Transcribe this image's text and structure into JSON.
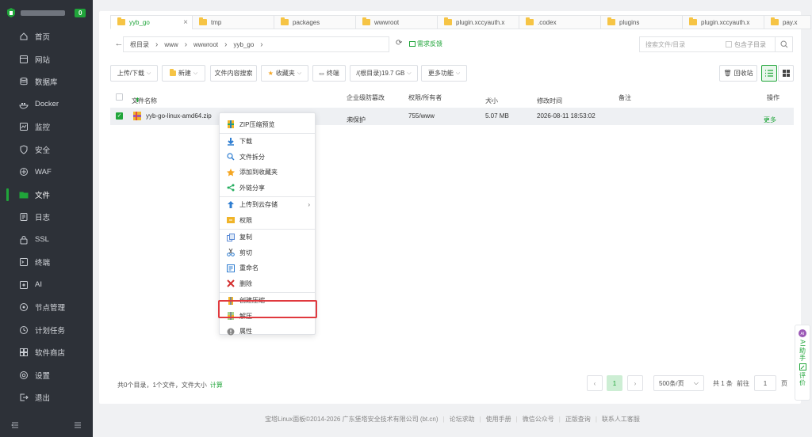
{
  "sidebar": {
    "badge": "0",
    "items": [
      {
        "label": "首页",
        "icon": "home-icon"
      },
      {
        "label": "网站",
        "icon": "website-icon"
      },
      {
        "label": "数据库",
        "icon": "database-icon"
      },
      {
        "label": "Docker",
        "icon": "docker-icon"
      },
      {
        "label": "监控",
        "icon": "monitor-icon"
      },
      {
        "label": "安全",
        "icon": "shield-icon"
      },
      {
        "label": "WAF",
        "icon": "waf-icon"
      },
      {
        "label": "文件",
        "icon": "folder-icon",
        "active": true
      },
      {
        "label": "日志",
        "icon": "log-icon"
      },
      {
        "label": "SSL",
        "icon": "ssl-icon"
      },
      {
        "label": "终端",
        "icon": "terminal-icon"
      },
      {
        "label": "AI",
        "icon": "ai-icon"
      },
      {
        "label": "节点管理",
        "icon": "node-icon"
      },
      {
        "label": "计划任务",
        "icon": "clock-icon"
      },
      {
        "label": "软件商店",
        "icon": "store-icon"
      },
      {
        "label": "设置",
        "icon": "gear-icon"
      },
      {
        "label": "退出",
        "icon": "logout-icon"
      }
    ]
  },
  "tabs": [
    {
      "label": "yyb_go",
      "active": true
    },
    {
      "label": "tmp"
    },
    {
      "label": "packages"
    },
    {
      "label": "wwwroot"
    },
    {
      "label": "plugin.xccyauth.x"
    },
    {
      "label": ".codex"
    },
    {
      "label": "plugins"
    },
    {
      "label": "plugin.xccyauth.x"
    },
    {
      "label": "pay.x"
    }
  ],
  "breadcrumb": [
    "根目录",
    "www",
    "wwwroot",
    "yyb_go"
  ],
  "feedback": "需求反馈",
  "search": {
    "placeholder": "搜索文件/目录",
    "include_sub": "包含子目录"
  },
  "toolbar": {
    "upload": "上传/下载",
    "new": "新建",
    "content_search": "文件内容搜索",
    "favorites": "收藏夹",
    "terminal": "终端",
    "disk": "/(根目录)19.7 GB",
    "more": "更多功能",
    "recycle": "回收站"
  },
  "table": {
    "headers": {
      "name": "文件名称",
      "protect": "企业级防篡改",
      "perm": "权限/所有者",
      "size": "大小",
      "mtime": "修改时间",
      "note": "备注",
      "ops": "操作"
    },
    "rows": [
      {
        "name": "yyb-go-linux-amd64.zip",
        "protect": "未保护",
        "perm": "755/www",
        "size": "5.07 MB",
        "mtime": "2026-08-11 18:53:02",
        "note": "",
        "ops": "更多"
      }
    ]
  },
  "context_menu": {
    "groups": [
      [
        {
          "label": "ZIP压缩预览",
          "icon": "zip-preview-icon"
        }
      ],
      [
        {
          "label": "下载",
          "icon": "download-icon"
        },
        {
          "label": "文件拆分",
          "icon": "split-icon"
        },
        {
          "label": "添加到收藏夹",
          "icon": "star-icon"
        },
        {
          "label": "外链分享",
          "icon": "share-icon"
        }
      ],
      [
        {
          "label": "上传到云存储",
          "icon": "cloud-upload-icon",
          "submenu": true
        },
        {
          "label": "权限",
          "icon": "permission-icon"
        }
      ],
      [
        {
          "label": "复制",
          "icon": "copy-icon"
        },
        {
          "label": "剪切",
          "icon": "cut-icon"
        },
        {
          "label": "重命名",
          "icon": "rename-icon"
        },
        {
          "label": "删除",
          "icon": "delete-icon"
        }
      ],
      [
        {
          "label": "创建压缩",
          "icon": "compress-icon"
        },
        {
          "label": "解压",
          "icon": "extract-icon",
          "highlighted": true
        },
        {
          "label": "属性",
          "icon": "info-icon"
        }
      ]
    ]
  },
  "summary": {
    "text": "共0个目录，1个文件，文件大小",
    "calc": "计算"
  },
  "pager": {
    "current": "1",
    "per_page": "500条/页",
    "total": "共 1 条",
    "goto": "前往",
    "goto_value": "1",
    "page_unit": "页"
  },
  "copyright": [
    "宝塔Linux面板©2014-2026 广东堡塔安全技术有限公司 (bt.cn)",
    "论坛求助",
    "使用手册",
    "微信公众号",
    "正版查询",
    "联系人工客服"
  ],
  "float": {
    "ai": "AI助手",
    "review": "评价"
  },
  "colors": {
    "accent": "#20a53a",
    "sidebar": "#2d3138",
    "highlight": "#e0393e"
  }
}
